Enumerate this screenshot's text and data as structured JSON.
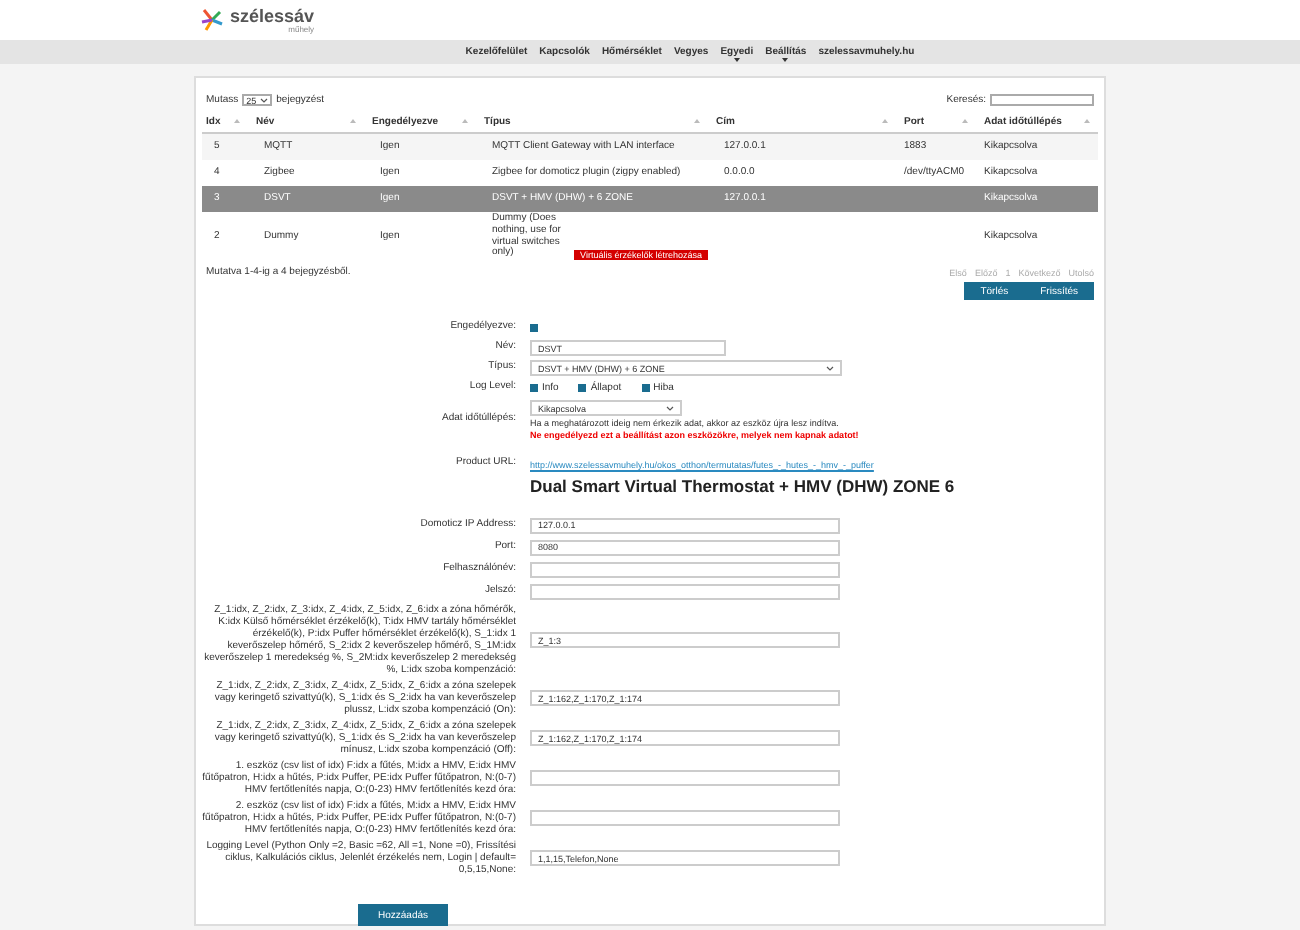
{
  "logo": {
    "text": "szélessáv",
    "subtext": "műhely"
  },
  "nav": [
    {
      "label": "Kezelőfelület",
      "dropdown": false
    },
    {
      "label": "Kapcsolók",
      "dropdown": false
    },
    {
      "label": "Hőmérséklet",
      "dropdown": false
    },
    {
      "label": "Vegyes",
      "dropdown": false
    },
    {
      "label": "Egyedi",
      "dropdown": true
    },
    {
      "label": "Beállítás",
      "dropdown": true
    },
    {
      "label": "szelessavmuhely.hu",
      "dropdown": false
    }
  ],
  "table_controls": {
    "show_label": "Mutass",
    "page_size": "25",
    "entries_label": "bejegyzést",
    "search_label": "Keresés:"
  },
  "table": {
    "columns": [
      "Idx",
      "Név",
      "Engedélyezve",
      "Típus",
      "Cím",
      "Port",
      "Adat időtúllépés"
    ],
    "rows": [
      {
        "idx": "5",
        "name": "MQTT",
        "enabled": "Igen",
        "type": "MQTT Client Gateway with LAN interface",
        "address": "127.0.0.1",
        "port": "1883",
        "timeout": "Kikapcsolva",
        "selected": false
      },
      {
        "idx": "4",
        "name": "Zigbee",
        "enabled": "Igen",
        "type": "Zigbee for domoticz plugin (zigpy enabled)",
        "address": "0.0.0.0",
        "port": "/dev/ttyACM0",
        "timeout": "Kikapcsolva",
        "selected": false
      },
      {
        "idx": "3",
        "name": "DSVT",
        "enabled": "Igen",
        "type": "DSVT + HMV (DHW) + 6 ZONE",
        "address": "127.0.0.1",
        "port": "",
        "timeout": "Kikapcsolva",
        "selected": true
      },
      {
        "idx": "2",
        "name": "Dummy",
        "enabled": "Igen",
        "type": "Dummy (Does nothing, use for virtual switches only)",
        "type_button": "Virtuális érzékelők létrehozása",
        "address": "",
        "port": "",
        "timeout": "Kikapcsolva",
        "selected": false
      }
    ]
  },
  "table_info": "Mutatva 1-4-ig a 4 bejegyzésből.",
  "pagination": [
    "Első",
    "Előző",
    "1",
    "Következő",
    "Utolsó"
  ],
  "table_buttons": [
    "Törlés",
    "Frissítés"
  ],
  "form": {
    "enabled": {
      "label": "Engedélyezve:",
      "checked": true
    },
    "name": {
      "label": "Név:",
      "value": "DSVT"
    },
    "type": {
      "label": "Típus:",
      "value": "DSVT + HMV (DHW) + 6 ZONE"
    },
    "log_level": {
      "label": "Log Level:",
      "options": [
        {
          "label": "Info",
          "checked": true
        },
        {
          "label": "Állapot",
          "checked": true
        },
        {
          "label": "Hiba",
          "checked": true
        }
      ]
    },
    "timeout": {
      "label": "Adat időtúllépés:",
      "value": "Kikapcsolva",
      "hint": "Ha a meghatározott ideig nem érkezik adat, akkor az eszköz újra lesz indítva.",
      "warning": "Ne engedélyezd ezt a beállítást azon eszközökre, melyek nem kapnak adatot!"
    },
    "product_url": {
      "label": "Product URL:",
      "value": "http://www.szelessavmuhely.hu/okos_otthon/termutatas/futes_-_hutes_-_hmv_-_puffer"
    },
    "heading": "Dual Smart Virtual Thermostat + HMV (DHW) ZONE 6",
    "params": [
      {
        "label": "Domoticz IP Address:",
        "value": "127.0.0.1"
      },
      {
        "label": "Port:",
        "value": "8080"
      },
      {
        "label": "Felhasználónév:"
      },
      {
        "label": "Jelszó:"
      },
      {
        "label": "Z_1:idx, Z_2:idx, Z_3:idx, Z_4:idx, Z_5:idx, Z_6:idx a zóna hőmérők, K:idx Külső hőmérséklet érzékelő(k), T:idx HMV tartály hőmérséklet érzékelő(k), P:idx Puffer hőmérséklet érzékelő(k), S_1:idx 1 keverőszelep hőmérő, S_2:idx 2 keverőszelep hőmérő, S_1M:idx keverőszelep 1 meredekség %, S_2M:idx keverőszelep 2 meredekség %, L:idx szoba kompenzáció:",
        "value": "Z_1:3"
      },
      {
        "label": "Z_1:idx, Z_2:idx, Z_3:idx, Z_4:idx, Z_5:idx, Z_6:idx a zóna szelepek vagy keringető szivattyú(k), S_1:idx és S_2:idx ha van keverőszelep plussz, L:idx szoba kompenzáció (On):",
        "value": "Z_1:162,Z_1:170,Z_1:174"
      },
      {
        "label": "Z_1:idx, Z_2:idx, Z_3:idx, Z_4:idx, Z_5:idx, Z_6:idx a zóna szelepek vagy keringető szivattyú(k), S_1:idx és S_2:idx ha van keverőszelep mínusz, L:idx szoba kompenzáció (Off):",
        "value": "Z_1:162,Z_1:170,Z_1:174"
      },
      {
        "label": "1. eszköz (csv list of idx) F:idx a fűtés, M:idx a HMV, E:idx HMV fűtőpatron, H:idx a hűtés, P:idx Puffer, PE:idx Puffer fűtőpatron, N:(0-7) HMV fertőtlenítés napja, O:(0-23) HMV fertőtlenítés kezd óra:"
      },
      {
        "label": "2. eszköz (csv list of idx) F:idx a fűtés, M:idx a HMV, E:idx HMV fűtőpatron, H:idx a hűtés, P:idx Puffer, PE:idx Puffer fűtőpatron, N:(0-7) HMV fertőtlenítés napja, O:(0-23) HMV fertőtlenítés kezd óra:"
      },
      {
        "label": "Logging Level (Python Only =2, Basic =62, All =1, None =0), Frissítési ciklus, Kalkulációs ciklus, Jelenlét érzékelés nem, Login | default= 0,5,15,None:",
        "value": "1,1,15,Telefon,None"
      }
    ],
    "submit": "Hozzáadás"
  }
}
